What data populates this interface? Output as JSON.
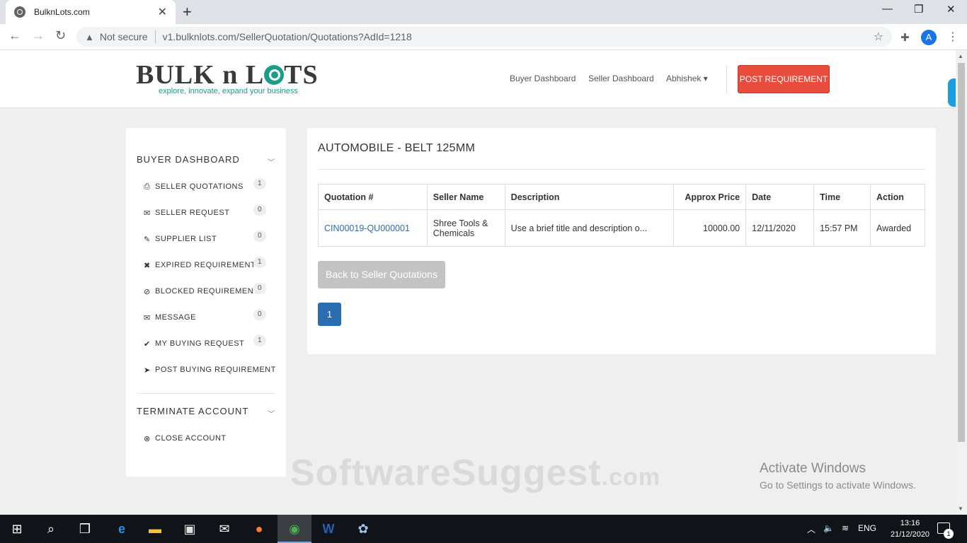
{
  "browser": {
    "tab_title": "BulknLots.com",
    "tab_close": "✕",
    "new_tab": "+",
    "not_secure": "Not secure",
    "url": "v1.bulknlots.com/SellerQuotation/Quotations?AdId=1218",
    "avatar_letter": "A"
  },
  "header": {
    "logo_text_1": "BULK n L",
    "logo_text_2": "TS",
    "tagline": "explore, innovate, expand your business",
    "nav": {
      "buyer_dashboard": "Buyer Dashboard",
      "seller_dashboard": "Seller Dashboard",
      "user": "Abhishek ▾"
    },
    "post_requirement": "POST REQUIREMENT"
  },
  "sidebar": {
    "buyer_title": "BUYER DASHBOARD",
    "items": [
      {
        "icon": "printer-icon",
        "glyph": "⎙",
        "label": "SELLER QUOTATIONS",
        "count": "1"
      },
      {
        "icon": "envelope-icon",
        "glyph": "✉",
        "label": "SELLER REQUEST",
        "count": "0"
      },
      {
        "icon": "edit-icon",
        "glyph": "✎",
        "label": "SUPPLIER LIST",
        "count": "0"
      },
      {
        "icon": "times-icon",
        "glyph": "✖",
        "label": "EXPIRED REQUIREMENTS",
        "count": "1"
      },
      {
        "icon": "ban-icon",
        "glyph": "⊘",
        "label": "BLOCKED REQUIREMENTS",
        "count": "0"
      },
      {
        "icon": "envelope-icon",
        "glyph": "✉",
        "label": "MESSAGE",
        "count": "0"
      },
      {
        "icon": "check-icon",
        "glyph": "✔",
        "label": "MY BUYING REQUEST",
        "count": "1"
      },
      {
        "icon": "paper-plane-icon",
        "glyph": "➤",
        "label": "POST BUYING REQUIREMENT",
        "count": ""
      }
    ],
    "terminate_title": "TERMINATE ACCOUNT",
    "close_account": {
      "icon": "times-circle-icon",
      "glyph": "⊗",
      "label": "CLOSE ACCOUNT"
    }
  },
  "main": {
    "title": "AUTOMOBILE - BELT 125MM",
    "columns": [
      "Quotation #",
      "Seller Name",
      "Description",
      "Approx Price",
      "Date",
      "Time",
      "Action"
    ],
    "rows": [
      {
        "quotation": "CIN00019-QU000001",
        "seller_name": "Shree Tools & Chemicals",
        "description": "Use a brief title and description o...",
        "approx_price": "10000.00",
        "date": "12/11/2020",
        "time": "15:57 PM",
        "action": "Awarded"
      }
    ],
    "back_button": "Back to Seller Quotations",
    "page": "1"
  },
  "overlay": {
    "watermark": "SoftwareSuggest",
    "watermark_suffix": ".com",
    "activate_title": "Activate Windows",
    "activate_sub": "Go to Settings to activate Windows."
  },
  "taskbar": {
    "language": "ENG",
    "time": "13:16",
    "date": "21/12/2020",
    "notifications": "1"
  },
  "colors": {
    "accent_red": "#e84c3d",
    "link_blue": "#2a6db0",
    "brand_teal": "#1a9e8a"
  }
}
